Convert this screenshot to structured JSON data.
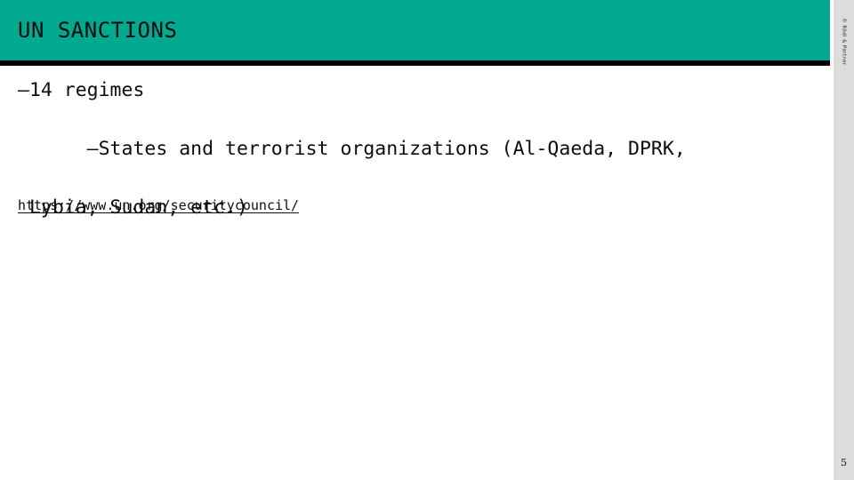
{
  "slide": {
    "title": "UN SANCTIONS",
    "page_number": "5",
    "copyright": "© Rödl & Partner",
    "colors": {
      "header_band": "#00a98f",
      "header_rule": "#000000",
      "side_strip": "#dcdcdc",
      "text": "#0d0d0d",
      "background": "#ffffff"
    }
  },
  "body": {
    "bullets": [
      {
        "marker": "–",
        "text": "14 regimes",
        "wrap": ""
      },
      {
        "marker": "–",
        "text": "States and terrorist organizations (Al-Qaeda, DPRK,",
        "wrap": "Lybia, Sudan, etc.)"
      }
    ],
    "bullet_1_line": "–14 regimes",
    "bullet_2_line": "–States and terrorist organizations (Al-Qaeda, DPRK,",
    "bullet_2_wrap": "Lybia, Sudan, etc.)",
    "link": {
      "label": "https://www.un.org/securitycouncil/"
    }
  }
}
